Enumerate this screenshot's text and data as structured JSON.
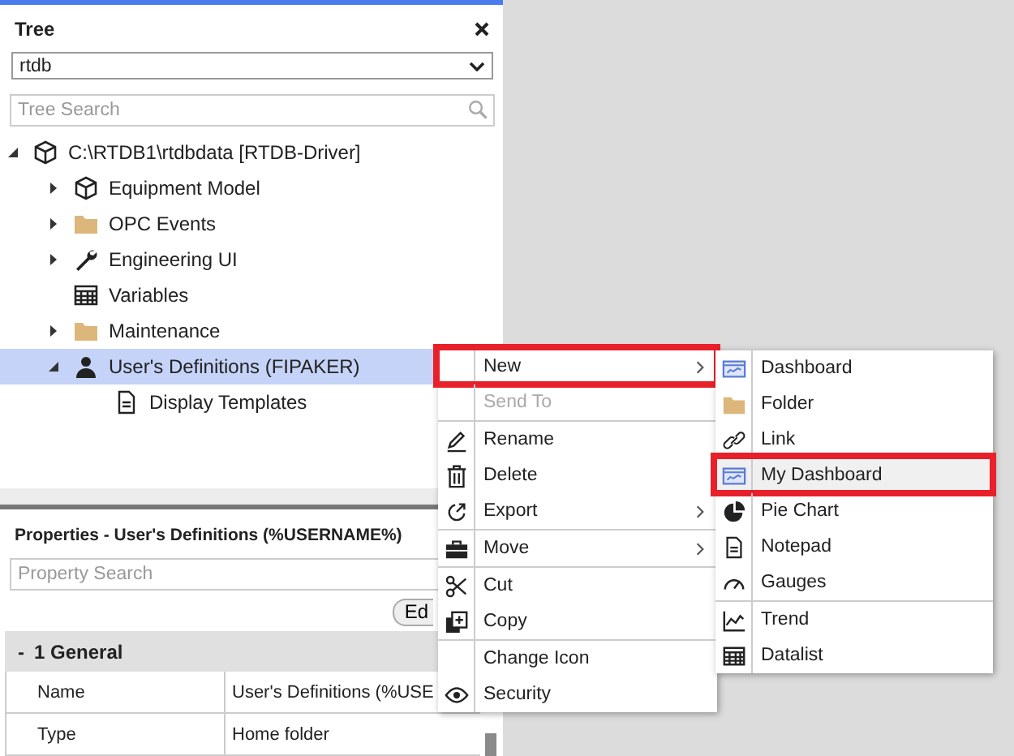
{
  "tree_panel": {
    "title": "Tree",
    "source_select": {
      "value": "rtdb"
    },
    "search": {
      "placeholder": "Tree Search"
    },
    "tree": [
      {
        "label": "C:\\RTDB1\\rtdbdata [RTDB-Driver]",
        "kind": "cube",
        "expanded": true,
        "selected": false,
        "children": [
          {
            "label": "Equipment Model",
            "kind": "cube",
            "expanded": false,
            "selected": false
          },
          {
            "label": "OPC Events",
            "kind": "folder",
            "expanded": false,
            "selected": false
          },
          {
            "label": "Engineering UI",
            "kind": "wrench",
            "expanded": false,
            "selected": false
          },
          {
            "label": "Variables",
            "kind": "table",
            "selected": false
          },
          {
            "label": "Maintenance",
            "kind": "folder",
            "expanded": false,
            "selected": false
          },
          {
            "label": "User's Definitions (FIPAKER)",
            "kind": "person",
            "expanded": true,
            "selected": true,
            "children": [
              {
                "label": "Display Templates",
                "kind": "document",
                "selected": false
              }
            ]
          }
        ]
      }
    ]
  },
  "properties_panel": {
    "title": "Properties - User's Definitions (%USERNAME%)",
    "search": {
      "placeholder": "Property Search"
    },
    "edit_button": "Ed",
    "group": {
      "toggle": "-",
      "label": "1 General"
    },
    "rows": [
      {
        "name": "Name",
        "value": "User's Definitions (%USE"
      },
      {
        "name": "Type",
        "value": "Home folder"
      }
    ]
  },
  "context_menu": {
    "groups": [
      [
        {
          "label": "New",
          "kind": "plain",
          "submenu": true,
          "disabled": false,
          "annotated": true
        },
        {
          "label": "Send To",
          "kind": "plain",
          "submenu": false,
          "disabled": true,
          "annotated": false
        }
      ],
      [
        {
          "label": "Rename",
          "kind": "pencil",
          "submenu": false,
          "disabled": false,
          "annotated": false
        },
        {
          "label": "Delete",
          "kind": "trash",
          "submenu": false,
          "disabled": false,
          "annotated": false
        },
        {
          "label": "Export",
          "kind": "export",
          "submenu": true,
          "disabled": false,
          "annotated": false
        }
      ],
      [
        {
          "label": "Move",
          "kind": "briefcase",
          "submenu": true,
          "disabled": false,
          "annotated": false
        }
      ],
      [
        {
          "label": "Cut",
          "kind": "scissors",
          "submenu": false,
          "disabled": false,
          "annotated": false
        },
        {
          "label": "Copy",
          "kind": "copy",
          "submenu": false,
          "disabled": false,
          "annotated": false
        }
      ],
      [
        {
          "label": "Change Icon",
          "kind": "plain",
          "submenu": false,
          "disabled": false,
          "annotated": false
        },
        {
          "label": "Security",
          "kind": "eye",
          "submenu": false,
          "disabled": false,
          "annotated": false
        }
      ]
    ]
  },
  "submenu": {
    "groups": [
      [
        {
          "label": "Dashboard",
          "kind": "dashboard",
          "selected": false,
          "annotated": false
        },
        {
          "label": "Folder",
          "kind": "folder",
          "selected": false,
          "annotated": false
        },
        {
          "label": "Link",
          "kind": "link",
          "selected": false,
          "annotated": false
        },
        {
          "label": "My Dashboard",
          "kind": "dashboard",
          "selected": true,
          "annotated": true
        },
        {
          "label": "Pie Chart",
          "kind": "pie",
          "selected": false,
          "annotated": false
        },
        {
          "label": "Notepad",
          "kind": "document",
          "selected": false,
          "annotated": false
        },
        {
          "label": "Gauges",
          "kind": "gauge",
          "selected": false,
          "annotated": false
        }
      ],
      [
        {
          "label": "Trend",
          "kind": "trend",
          "selected": false,
          "annotated": false
        },
        {
          "label": "Datalist",
          "kind": "table",
          "selected": false,
          "annotated": false
        }
      ]
    ]
  }
}
